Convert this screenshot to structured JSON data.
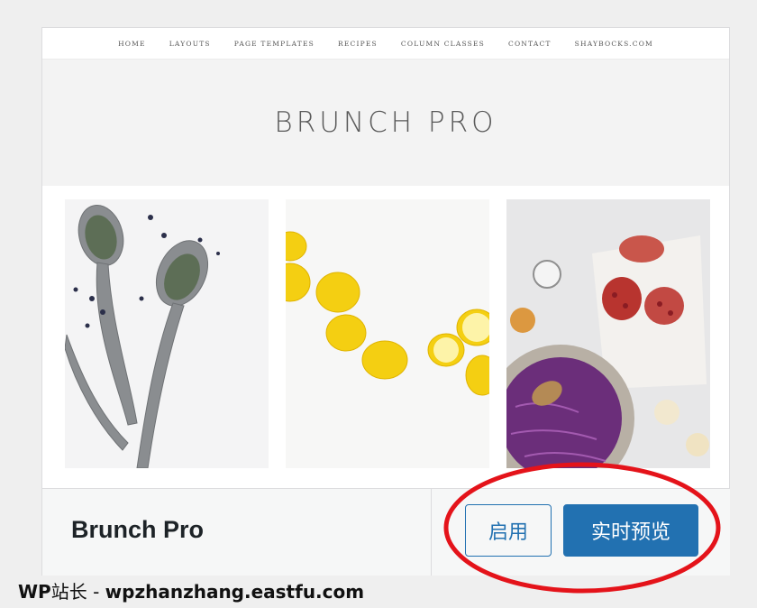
{
  "preview": {
    "nav_items": [
      "HOME",
      "LAYOUTS",
      "PAGE TEMPLATES",
      "RECIPES",
      "COLUMN CLASSES",
      "CONTACT",
      "SHAYBOCKS.COM"
    ],
    "site_title": "BRUNCH PRO"
  },
  "theme": {
    "name": "Brunch Pro",
    "activate_label": "启用",
    "live_preview_label": "实时预览"
  },
  "annotation": {
    "color": "#e4131a"
  },
  "watermark": {
    "brand": "WP",
    "cn": "站长",
    "separator": " - ",
    "url": "wpzhanzhang.eastfu.com"
  },
  "colors": {
    "primary": "#2271b1",
    "card_border": "#dcdcde"
  }
}
